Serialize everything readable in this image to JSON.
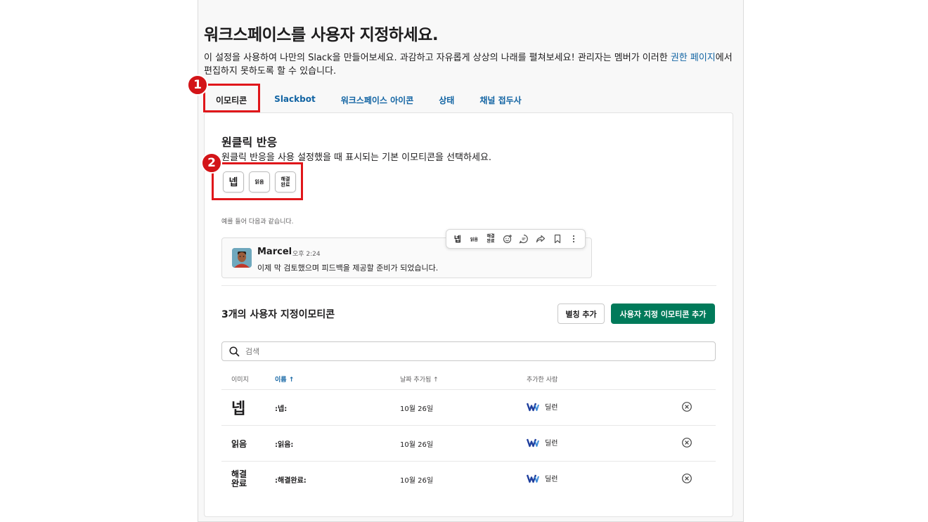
{
  "page": {
    "title": "워크스페이스를 사용자 지정하세요.",
    "description_line1": "이 설정을 사용하여 나만의 Slack을 만들어보세요. 과감하고 자유롭게 상상의 나래를 펼쳐보세요! 관리자는 멤버가 이러한 ",
    "description_link": "권한 페이지",
    "description_line2": "에서 편집하지 못하도록 할 수 있습니다."
  },
  "tabs": [
    {
      "label": "이모티콘"
    },
    {
      "label": "Slackbot"
    },
    {
      "label": "워크스페이스 아이콘"
    },
    {
      "label": "상태"
    },
    {
      "label": "채널 접두사"
    }
  ],
  "annotations": {
    "badge1": "1",
    "badge2": "2"
  },
  "one_click": {
    "title": "원클릭 반응",
    "description": "원클릭 반응을 사용 설정했을 때 표시되는 기본 이모티콘을 선택하세요.",
    "emojis": [
      "넵",
      "읽음",
      "해결완료"
    ],
    "emoji_top": "해결",
    "emoji_bottom": "완료"
  },
  "example": {
    "label": "예를 들어 다음과 같습니다.",
    "author": "Marcel",
    "time": "오후 2:24",
    "text": "이제 막 검토했으며 피드백을 제공할 준비가 되었습니다.",
    "hover_icons": [
      "넵",
      "읽음",
      "해결완료",
      "add-reaction-icon",
      "reply-thread-icon",
      "share-icon",
      "bookmark-icon",
      "more-icon"
    ]
  },
  "custom": {
    "title": "3개의 사용자 지정이모티콘",
    "alias_button": "별칭 추가",
    "add_button": "사용자 지정 이모티콘 추가",
    "search_placeholder": "검색",
    "columns": {
      "image": "이미지",
      "name": "이름 ↑",
      "date": "날짜 추가됨 ↑",
      "added_by": "추가한 사람"
    },
    "rows": [
      {
        "image": "넵",
        "name": ":넵:",
        "date": "10월 26일",
        "added_by": "딜런"
      },
      {
        "image": "읽음",
        "name": ":읽음:",
        "date": "10월 26일",
        "added_by": "딜런"
      },
      {
        "image_top": "해결",
        "image_bottom": "완료",
        "name": ":해결완료:",
        "date": "10월 26일",
        "added_by": "딜런"
      }
    ]
  },
  "colors": {
    "accent": "#1264a3",
    "primary_button": "#007a5a",
    "highlight": "#e0161a"
  }
}
